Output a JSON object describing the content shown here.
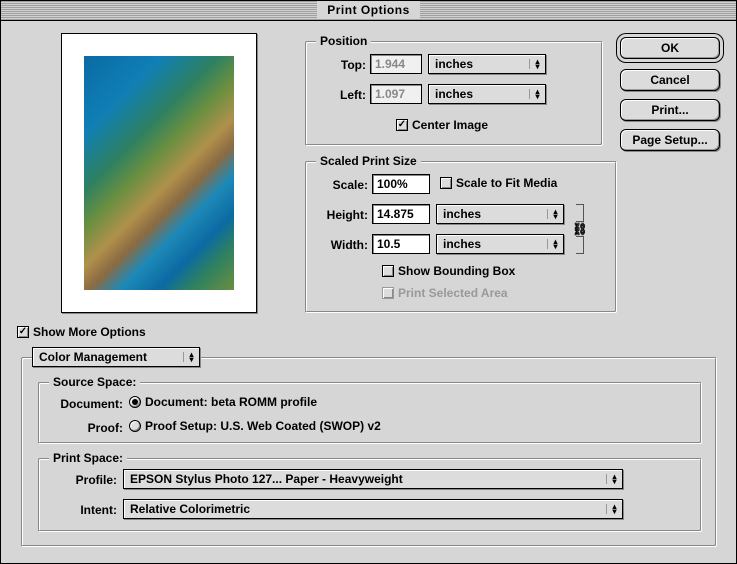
{
  "window": {
    "title": "Print Options"
  },
  "buttons": {
    "ok": "OK",
    "cancel": "Cancel",
    "print": "Print...",
    "page_setup": "Page Setup..."
  },
  "position": {
    "title": "Position",
    "top_label": "Top:",
    "top_value": "1.944",
    "top_unit": "inches",
    "left_label": "Left:",
    "left_value": "1.097",
    "left_unit": "inches",
    "center_label": "Center Image",
    "center_checked": true
  },
  "scaled": {
    "title": "Scaled Print Size",
    "scale_label": "Scale:",
    "scale_value": "100%",
    "fit_label": "Scale to Fit Media",
    "fit_checked": false,
    "height_label": "Height:",
    "height_value": "14.875",
    "height_unit": "inches",
    "width_label": "Width:",
    "width_value": "10.5",
    "width_unit": "inches",
    "bbox_label": "Show Bounding Box",
    "bbox_checked": false,
    "selarea_label": "Print Selected Area",
    "selarea_checked": false
  },
  "more": {
    "label": "Show More Options",
    "checked": true,
    "section_popup": "Color Management"
  },
  "source": {
    "title": "Source Space:",
    "document_label": "Document:",
    "document_value": "Document:  beta ROMM profile",
    "proof_label": "Proof:",
    "proof_value": "Proof Setup:  U.S. Web Coated (SWOP) v2",
    "selected": "document"
  },
  "printspace": {
    "title": "Print Space:",
    "profile_label": "Profile:",
    "profile_value": "EPSON Stylus Photo 127... Paper - Heavyweight",
    "intent_label": "Intent:",
    "intent_value": "Relative Colorimetric"
  }
}
